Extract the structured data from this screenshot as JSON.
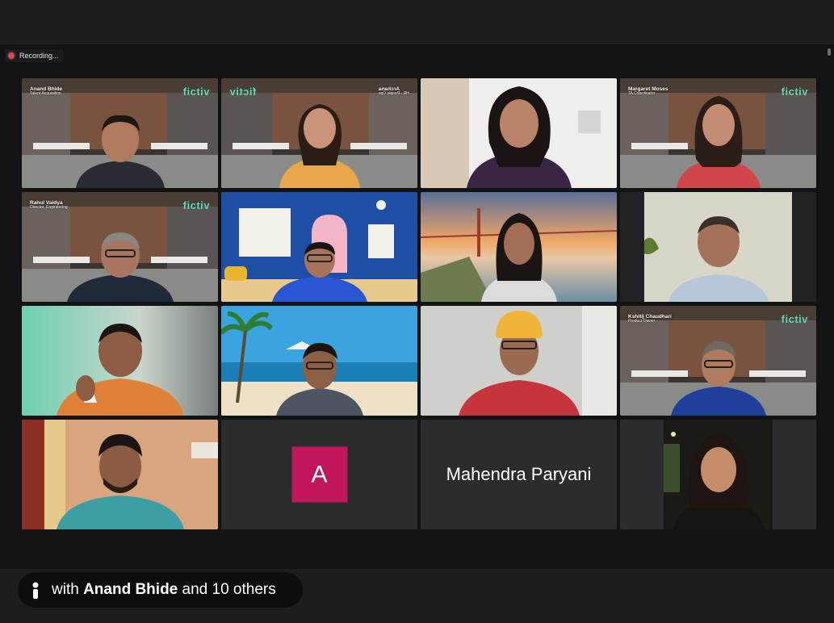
{
  "recording": {
    "label": "Recording..."
  },
  "colors": {
    "accent_active": "#66d17a",
    "avatar_bg": "#c2185b",
    "brand_logo": "#5fd6b4"
  },
  "tiles": [
    {
      "name": "Anand Bhide",
      "role": "Talent Acquisition",
      "logo": "fictiv",
      "bg": "office",
      "mirror": false
    },
    {
      "name": "Archana",
      "role": "HR - People Ops",
      "logo": "fictiv",
      "bg": "office",
      "mirror": true
    },
    {
      "name": "",
      "role": "",
      "logo": "",
      "bg": "home-white",
      "mirror": false
    },
    {
      "name": "Margaret Moses",
      "role": "TA Coordinator",
      "logo": "fictiv",
      "bg": "office",
      "mirror": false,
      "active": true
    },
    {
      "name": "Rahul Vaidya",
      "role": "Director, Engineering",
      "logo": "fictiv",
      "bg": "office",
      "mirror": false
    },
    {
      "name": "",
      "role": "",
      "logo": "",
      "bg": "blue-room",
      "mirror": false
    },
    {
      "name": "",
      "role": "",
      "logo": "",
      "bg": "bridge",
      "mirror": false
    },
    {
      "name": "",
      "role": "",
      "logo": "",
      "bg": "wall",
      "mirror": false
    },
    {
      "name": "",
      "role": "",
      "logo": "",
      "bg": "green-blur",
      "mirror": false
    },
    {
      "name": "",
      "role": "",
      "logo": "",
      "bg": "beach",
      "mirror": false
    },
    {
      "name": "",
      "role": "",
      "logo": "",
      "bg": "white-blur",
      "mirror": false
    },
    {
      "name": "Kshitij Chaudhari",
      "role": "Product Owner",
      "logo": "fictiv",
      "bg": "office",
      "mirror": false
    },
    {
      "name": "",
      "role": "",
      "logo": "",
      "bg": "room-warm",
      "mirror": false
    },
    {
      "name": "",
      "role": "",
      "logo": "",
      "bg": "",
      "mirror": false,
      "avatar_letter": "A"
    },
    {
      "name": "",
      "role": "",
      "logo": "",
      "bg": "",
      "mirror": false,
      "display_name": "Mahendra Paryani"
    },
    {
      "name": "",
      "role": "",
      "logo": "",
      "bg": "night",
      "mirror": false
    }
  ],
  "participants_pill": {
    "prefix": "with",
    "host": "Anand Bhide",
    "suffix": "and 10 others"
  }
}
